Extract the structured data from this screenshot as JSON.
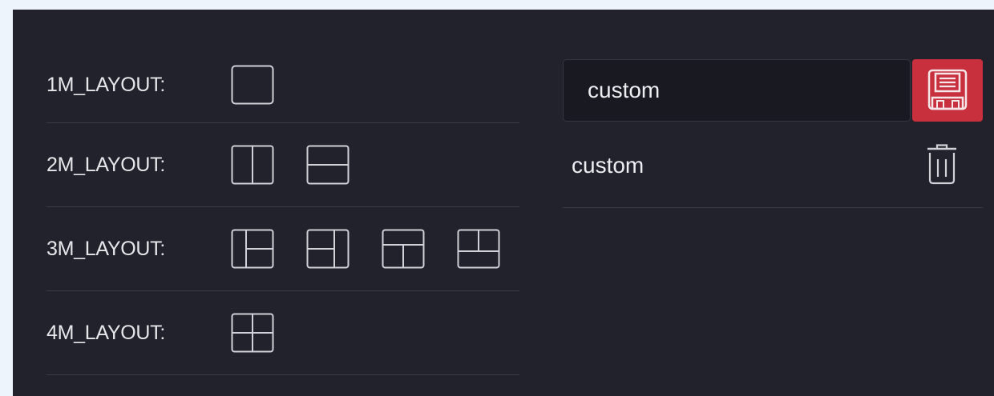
{
  "layouts": [
    {
      "label": "1M_LAYOUT:",
      "icons": [
        "single-pane-layout-icon"
      ]
    },
    {
      "label": "2M_LAYOUT:",
      "icons": [
        "vertical-split-layout-icon",
        "horizontal-split-layout-icon"
      ]
    },
    {
      "label": "3M_LAYOUT:",
      "icons": [
        "left-full-right-split-layout-icon",
        "left-split-right-full-layout-icon",
        "top-full-bottom-split-layout-icon",
        "top-split-bottom-full-layout-icon"
      ]
    },
    {
      "label": "4M_LAYOUT:",
      "icons": [
        "quad-grid-layout-icon"
      ]
    }
  ],
  "preset": {
    "input_value": "custom",
    "save_icon": "floppy-disk-icon",
    "saved_items": [
      {
        "name": "custom",
        "delete_icon": "trash-icon"
      }
    ]
  },
  "colors": {
    "background": "#eef4fc",
    "panel": "#21222b",
    "input_bg": "#191a21",
    "accent": "#c8303d",
    "text": "#e6e7ea",
    "divider": "#3a3b45"
  }
}
